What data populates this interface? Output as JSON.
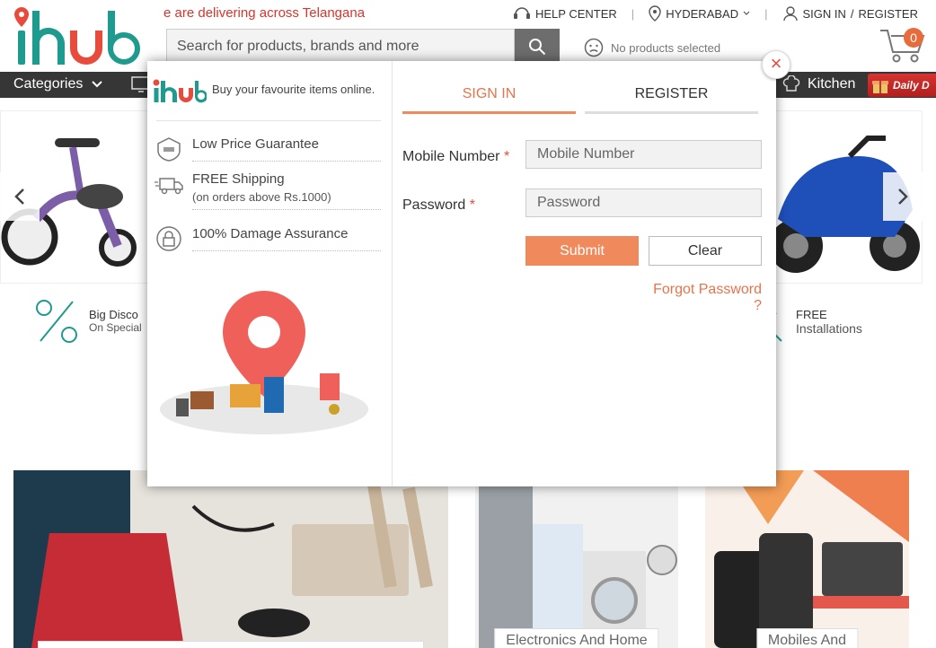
{
  "header": {
    "ticker": "e are delivering across Telangana",
    "help_center": "HELP CENTER",
    "location": "HYDERABAD",
    "sign_in": "SIGN IN",
    "slash": "/",
    "register": "REGISTER",
    "search_placeholder": "Search for products, brands and more",
    "no_products": "No products selected",
    "cart_count": "0"
  },
  "nav": {
    "categories": "Categories",
    "kitchen": "Kitchen",
    "daily": "Daily D"
  },
  "usp": {
    "left_title": "Big Disco",
    "left_sub": "On Special",
    "right_title": "FREE",
    "right_sub": "Installations"
  },
  "tiles": [
    {
      "label": ""
    },
    {
      "label": "Electronics And Home"
    },
    {
      "label": "Mobiles And"
    }
  ],
  "modal": {
    "tagline": "Buy your favourite items online.",
    "features": [
      {
        "label": "Low Price Guarantee",
        "sub": ""
      },
      {
        "label": "FREE Shipping",
        "sub": "(on orders above Rs.1000)"
      },
      {
        "label": "100% Damage Assurance",
        "sub": ""
      }
    ],
    "close": "×",
    "tab_signin": "SIGN IN",
    "tab_register": "REGISTER",
    "mobile_label": "Mobile Number",
    "password_label": "Password",
    "required_mark": "*",
    "mobile_placeholder": "Mobile Number",
    "password_placeholder": "Password",
    "submit": "Submit",
    "clear": "Clear",
    "forgot": "Forgot Password ?"
  },
  "colors": {
    "accent": "#f08a5d",
    "logo_red": "#e84b3b",
    "logo_teal": "#1f9a8e",
    "nav_bg": "#363636"
  }
}
